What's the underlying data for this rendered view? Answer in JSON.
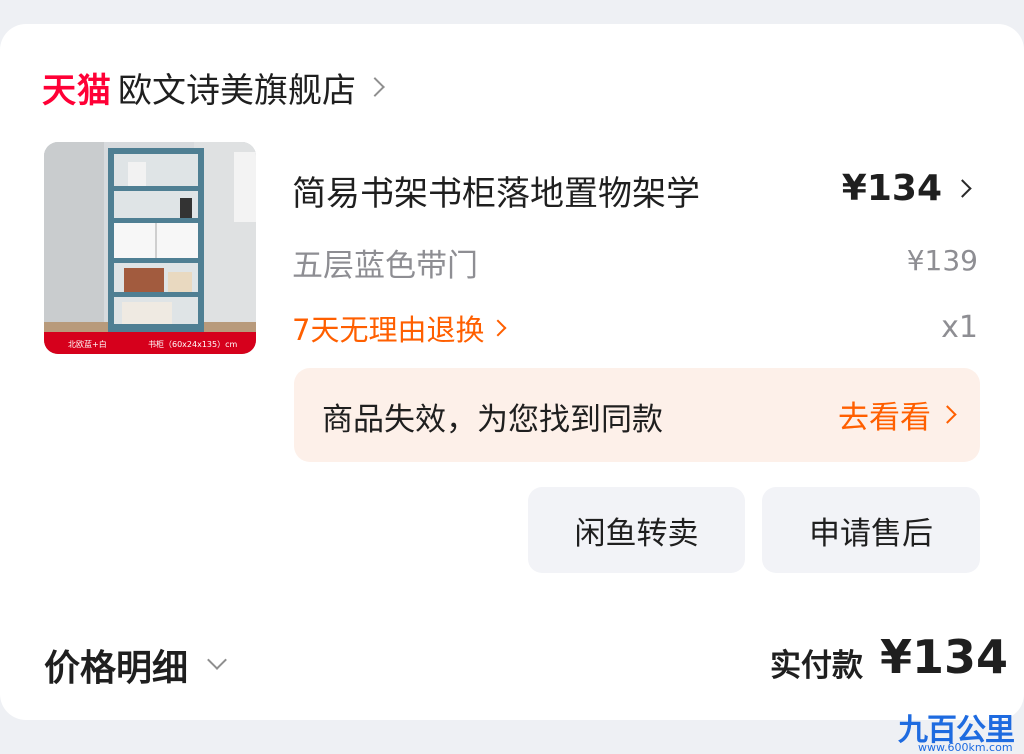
{
  "shop": {
    "platform_logo": "天猫",
    "name": "欧文诗美旗舰店"
  },
  "product": {
    "image_labels": {
      "left": "北欧蓝+白",
      "right": "书柜（60x24x135）cm"
    },
    "title": "简易书架书柜落地置物架学",
    "price": "¥134",
    "variant": "五层蓝色带门",
    "original_price": "¥139",
    "returns_policy": "7天无理由退换",
    "quantity": "x1"
  },
  "notice": {
    "text": "商品失效，为您找到同款",
    "link_label": "去看看"
  },
  "actions": {
    "resell_label": "闲鱼转卖",
    "aftersale_label": "申请售后"
  },
  "summary": {
    "price_detail_label": "价格明细",
    "paid_label": "实付款",
    "paid_amount": "¥134"
  },
  "watermark": {
    "logo": "九百公里",
    "url": "www.600km.com"
  },
  "colors": {
    "tmall_red": "#ff0036",
    "accent_orange": "#ff5f00",
    "notice_bg": "#fdf0e9",
    "button_bg": "#f2f3f7"
  }
}
